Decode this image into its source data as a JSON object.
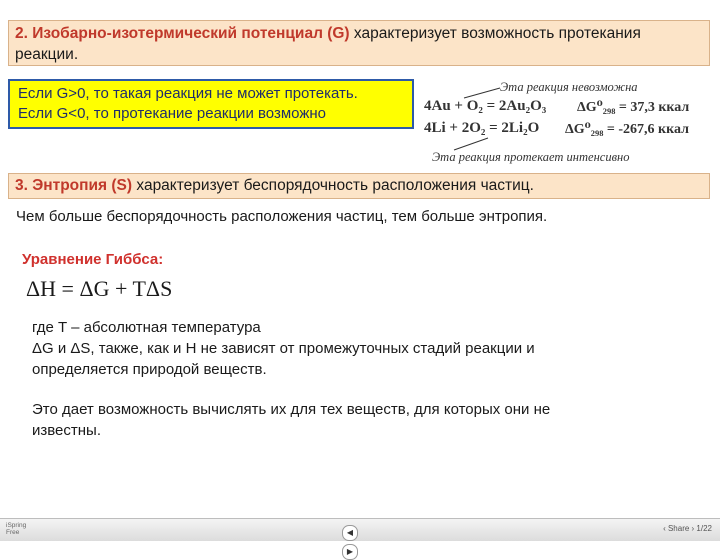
{
  "section2": {
    "heading": "2. Изобарно-изотермический потенциал (G)",
    "text_line1": " характеризует возможность протекания",
    "text_line2": "реакции."
  },
  "conditions": {
    "line1": "Если G>0, то такая реакция не может протекать.",
    "line2": "Если   G<0, то протекание реакции возможно"
  },
  "reactions": {
    "note_top": "Эта реакция невозможна",
    "eq1": "4Au + O₂ = 2Au₂O₃",
    "val1": "ΔG⁰₂₉₈ = 37,3 ккал",
    "eq2": "4Li + 2O₂ = 2Li₂O",
    "val2": "ΔG⁰₂₉₈ = -267,6 ккал",
    "note_bottom": "Эта реакция протекает интенсивно"
  },
  "section3": {
    "heading": "3. Энтропия (S)",
    "text": "  характеризует беспорядочность расположения частиц."
  },
  "entropy_text": "Чем больше беспорядочность расположения частиц, тем больше энтропия.",
  "gibbs": {
    "heading": "Уравнение Гиббса:",
    "formula": "ΔH = ΔG + TΔS",
    "line1": "где T – абсолютная температура",
    "line2": "ΔG и  ΔS, также, как и Н не зависят от промежуточных стадий реакции и",
    "line3": "определяется природой веществ.",
    "line4": "Это дает возможность вычислять их для тех веществ, для которых они не",
    "line5": "известны."
  },
  "player": {
    "left_line1": "iSpring",
    "left_line2": "Free",
    "prev_icon": "prev-arrow-icon",
    "next_icon": "next-arrow-icon",
    "right_text": "‹ Share     ›  1/22"
  },
  "colors": {
    "peach_box": "#fce4c8",
    "yellow_box": "#ffff00",
    "box_border": "#2e5aa8",
    "heading_red": "#c0392b"
  }
}
